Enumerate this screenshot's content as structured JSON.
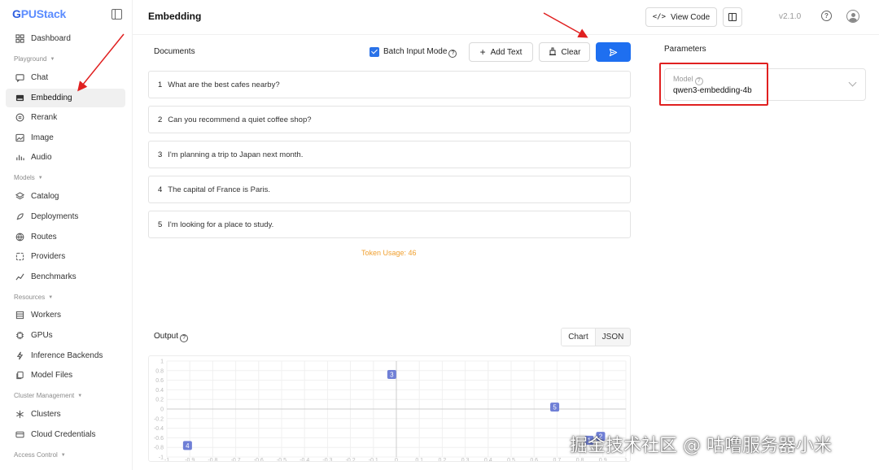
{
  "app": {
    "logo_text": "GPUStack",
    "version": "v2.1.0"
  },
  "sidebar": {
    "groups": {
      "playground": "Playground",
      "models": "Models",
      "resources": "Resources",
      "cluster_management": "Cluster Management",
      "access_control": "Access Control"
    },
    "items": {
      "dashboard": "Dashboard",
      "chat": "Chat",
      "embedding": "Embedding",
      "rerank": "Rerank",
      "image": "Image",
      "audio": "Audio",
      "catalog": "Catalog",
      "deployments": "Deployments",
      "routes": "Routes",
      "providers": "Providers",
      "benchmarks": "Benchmarks",
      "workers": "Workers",
      "gpus": "GPUs",
      "inference_backends": "Inference Backends",
      "model_files": "Model Files",
      "clusters": "Clusters",
      "cloud_credentials": "Cloud Credentials"
    },
    "active_item": "Embedding"
  },
  "header": {
    "title": "Embedding",
    "view_code_label": "View Code"
  },
  "documents": {
    "label": "Documents",
    "batch_input_mode_label": "Batch Input Mode",
    "batch_input_mode_checked": true,
    "add_text_label": "Add Text",
    "clear_label": "Clear",
    "items": [
      {
        "num": "1",
        "text": "What are the best cafes nearby?"
      },
      {
        "num": "2",
        "text": "Can you recommend a quiet coffee shop?"
      },
      {
        "num": "3",
        "text": "I'm planning a trip to Japan next month."
      },
      {
        "num": "4",
        "text": "The capital of France is Paris."
      },
      {
        "num": "5",
        "text": "I'm looking for a place to study."
      }
    ],
    "token_usage": "Token Usage: 46"
  },
  "output": {
    "label": "Output",
    "tabs": [
      "Chart",
      "JSON"
    ],
    "active_tab": "Chart"
  },
  "parameters": {
    "label": "Parameters",
    "model_label": "Model",
    "model_value": "qwen3-embedding-4b"
  },
  "chart_data": {
    "type": "scatter",
    "title": "",
    "xlabel": "",
    "ylabel": "",
    "xlim": [
      -1,
      1
    ],
    "ylim": [
      -1,
      1
    ],
    "x_ticks": [
      "-1",
      "-0.9",
      "-0.8",
      "-0.7",
      "-0.6",
      "-0.5",
      "-0.4",
      "-0.3",
      "-0.2",
      "-0.1",
      "0",
      "0.1",
      "0.2",
      "0.3",
      "0.4",
      "0.5",
      "0.6",
      "0.7",
      "0.8",
      "0.9",
      "1"
    ],
    "y_ticks": [
      "1",
      "0.8",
      "0.6",
      "0.4",
      "0.2",
      "0",
      "-0.2",
      "-0.4",
      "-0.6",
      "-0.8",
      "-1"
    ],
    "grid": true,
    "points": [
      {
        "label": "1",
        "x": 0.84,
        "y": -0.65
      },
      {
        "label": "2",
        "x": 0.89,
        "y": -0.57
      },
      {
        "label": "3",
        "x": -0.02,
        "y": 0.72
      },
      {
        "label": "4",
        "x": -0.91,
        "y": -0.76
      },
      {
        "label": "5",
        "x": 0.69,
        "y": 0.04
      }
    ]
  },
  "colors": {
    "accent": "#1e6ff0",
    "highlight": "#e02020",
    "token_usage": "#f0a030",
    "point_fill": "#6f7fd6"
  },
  "watermark": {
    "text": "掘金技术社区 @ 咕噜服务器小米"
  }
}
